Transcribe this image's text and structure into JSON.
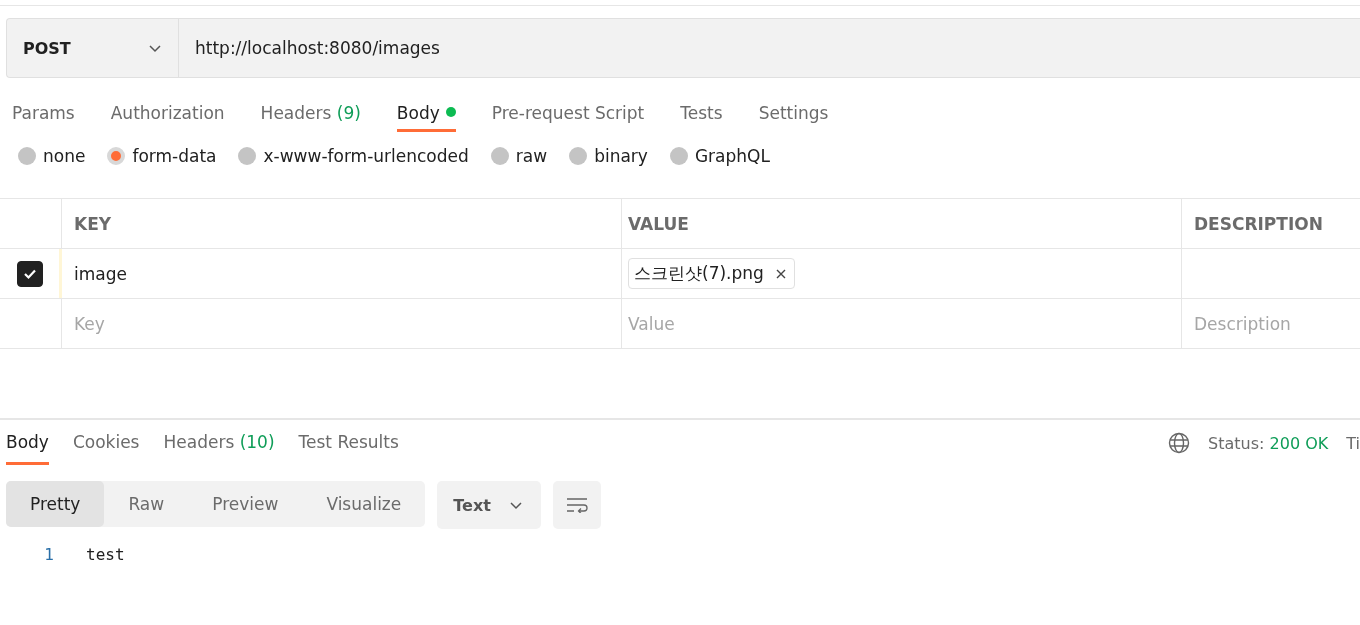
{
  "request": {
    "method": "POST",
    "url": "http://localhost:8080/images"
  },
  "tabs": [
    {
      "label": "Params",
      "selected": false
    },
    {
      "label": "Authorization",
      "selected": false
    },
    {
      "label": "Headers",
      "count": "(9)",
      "selected": false
    },
    {
      "label": "Body",
      "selected": true,
      "dot": true
    },
    {
      "label": "Pre-request Script",
      "selected": false
    },
    {
      "label": "Tests",
      "selected": false
    },
    {
      "label": "Settings",
      "selected": false
    }
  ],
  "body_types": [
    {
      "label": "none",
      "selected": false
    },
    {
      "label": "form-data",
      "selected": true
    },
    {
      "label": "x-www-form-urlencoded",
      "selected": false
    },
    {
      "label": "raw",
      "selected": false
    },
    {
      "label": "binary",
      "selected": false
    },
    {
      "label": "GraphQL",
      "selected": false
    }
  ],
  "table": {
    "columns": [
      "KEY",
      "VALUE",
      "DESCRIPTION"
    ],
    "rows": [
      {
        "checked": true,
        "key": "image",
        "file": "스크린샷(7).png"
      }
    ],
    "placeholders": {
      "key": "Key",
      "value": "Value",
      "description": "Description"
    }
  },
  "response": {
    "tabs": [
      {
        "label": "Body",
        "selected": true
      },
      {
        "label": "Cookies",
        "selected": false
      },
      {
        "label": "Headers",
        "count": "(10)",
        "selected": false
      },
      {
        "label": "Test Results",
        "selected": false
      }
    ],
    "status_label": "Status:",
    "status": "200 OK",
    "cut_label": "Ti",
    "views": [
      {
        "label": "Pretty",
        "selected": true
      },
      {
        "label": "Raw",
        "selected": false
      },
      {
        "label": "Preview",
        "selected": false
      },
      {
        "label": "Visualize",
        "selected": false
      }
    ],
    "format": "Text",
    "lines": [
      {
        "number": "1",
        "text": "test"
      }
    ]
  }
}
